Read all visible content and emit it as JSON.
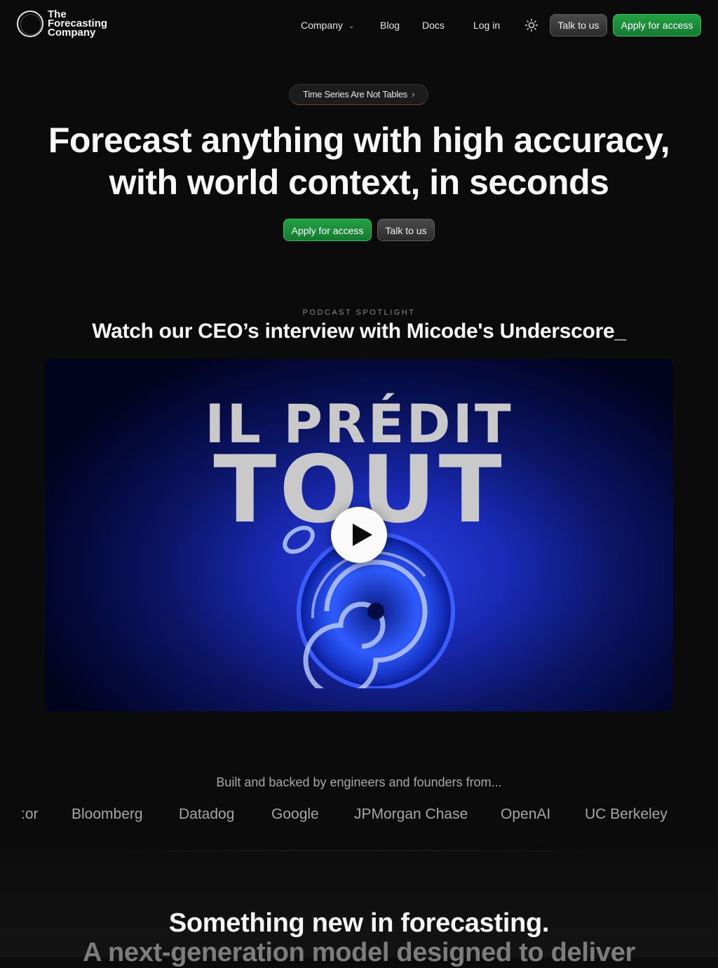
{
  "header": {
    "logo_lines": [
      "The",
      "Forecasting",
      "Company"
    ],
    "nav": {
      "company": "Company",
      "blog": "Blog",
      "docs": "Docs",
      "login": "Log in"
    },
    "theme_icon": "sun-icon",
    "talk_label": "Talk to us",
    "apply_label": "Apply for access"
  },
  "hero": {
    "pill_label": "Time Series Are Not Tables",
    "pill_arrow": "›",
    "title_line1": "Forecast anything with high accuracy,",
    "title_line2": "with world context, in seconds",
    "apply_label": "Apply for access",
    "talk_label": "Talk to us"
  },
  "podcast": {
    "eyebrow": "PODCAST SPOTLIGHT",
    "title": "Watch our CEO’s interview with Micode's Underscore_",
    "thumbnail_line1": "IL PRÉDIT",
    "thumbnail_line2": "TOUT",
    "play_icon": "play-icon"
  },
  "logos": {
    "intro": "Built and backed by engineers and founders from...",
    "companies": [
      ":or",
      "Bloomberg",
      "Datadog",
      "Google",
      "JPMorgan Chase",
      "OpenAI",
      "UC Berkeley"
    ]
  },
  "section": {
    "title": "Something new in forecasting.",
    "subtitle": "A next-generation model designed to deliver"
  },
  "colors": {
    "background": "#0b0b0b",
    "accent_green": "#1f9a40",
    "video_blue": "#1a2bb8"
  }
}
